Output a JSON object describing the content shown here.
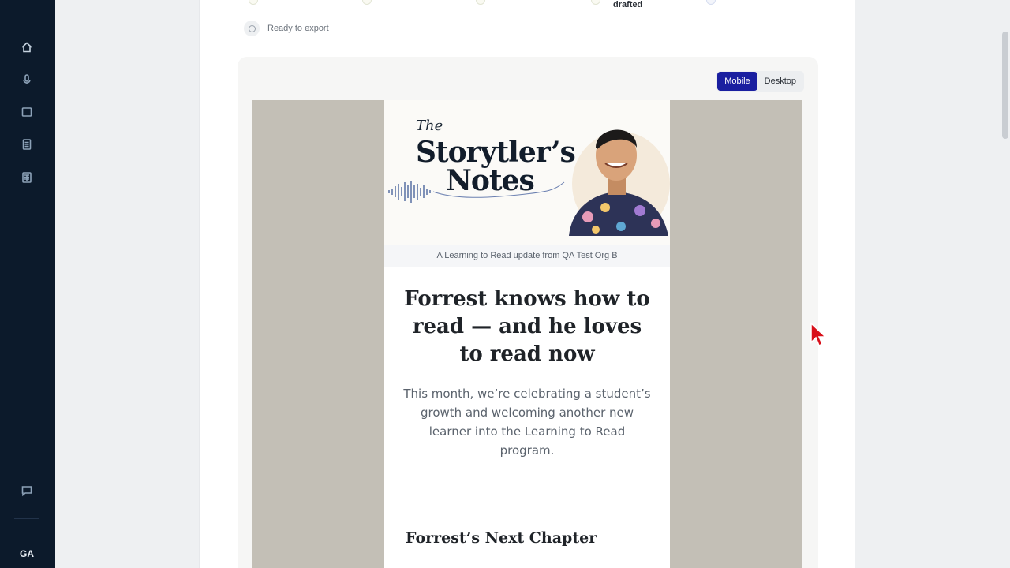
{
  "nav": {
    "items": [
      {
        "name": "home-icon",
        "label": "Home"
      },
      {
        "name": "microphone-icon",
        "label": "Recordings"
      },
      {
        "name": "book-icon",
        "label": "Stories"
      },
      {
        "name": "document-icon",
        "label": "Documents"
      },
      {
        "name": "newsletter-icon",
        "label": "Newsletters"
      }
    ],
    "chat_icon": "chat-icon",
    "avatar_initials": "GA"
  },
  "progress": {
    "drafted_label": "drafted",
    "export_label": "Ready to export"
  },
  "preview": {
    "toggle": {
      "mobile": "Mobile",
      "desktop": "Desktop",
      "active": "Mobile"
    },
    "colors": {
      "accent": "#1a1fa0",
      "background": "#c3bfb6"
    }
  },
  "email": {
    "logo": {
      "the": "The",
      "title_line1": "Storytler’s",
      "title_line2": "Notes"
    },
    "tagline": "A Learning to Read update from QA Test Org B",
    "headline": "Forrest knows how to read — and he loves to read now",
    "intro": "This month, we’re celebrating a student’s growth and welcoming another new learner into the Learning to Read program.",
    "section_title": "Forrest’s Next Chapter"
  }
}
